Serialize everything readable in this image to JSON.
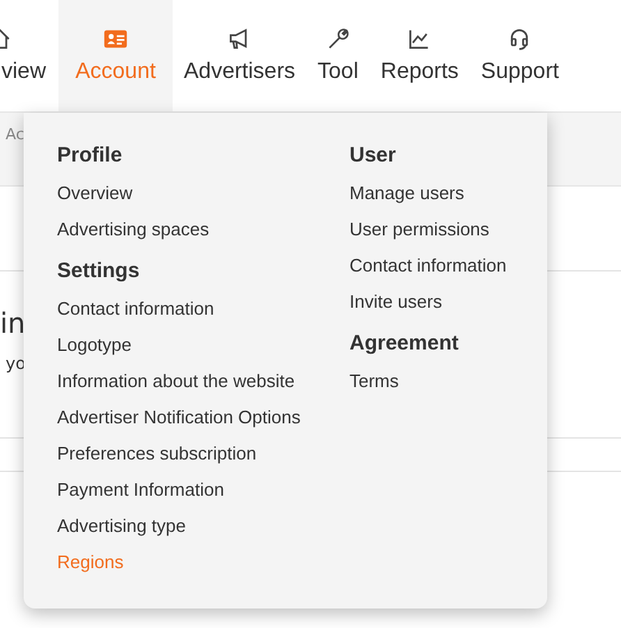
{
  "nav": [
    {
      "label": "view",
      "kind": "home",
      "selected": false
    },
    {
      "label": "Account",
      "kind": "card",
      "selected": true
    },
    {
      "label": "Advertisers",
      "kind": "megaphone",
      "selected": false
    },
    {
      "label": "Tool",
      "kind": "wrench",
      "selected": false
    },
    {
      "label": "Reports",
      "kind": "chart",
      "selected": false
    },
    {
      "label": "Support",
      "kind": "headset",
      "selected": false
    }
  ],
  "background": {
    "breadcrumb": "Ac",
    "heading": "in",
    "text": "yo"
  },
  "menu": {
    "columns": [
      [
        {
          "title": "Profile",
          "items": [
            {
              "label": "Overview",
              "selected": false
            },
            {
              "label": "Advertising spaces",
              "selected": false
            }
          ]
        },
        {
          "title": "Settings",
          "items": [
            {
              "label": "Contact information",
              "selected": false
            },
            {
              "label": "Logotype",
              "selected": false
            },
            {
              "label": "Information about the website",
              "selected": false
            },
            {
              "label": "Advertiser Notification Options",
              "selected": false
            },
            {
              "label": "Preferences subscription",
              "selected": false
            },
            {
              "label": "Payment Information",
              "selected": false
            },
            {
              "label": "Advertising type",
              "selected": false
            },
            {
              "label": "Regions",
              "selected": true
            }
          ]
        }
      ],
      [
        {
          "title": "User",
          "items": [
            {
              "label": "Manage users",
              "selected": false
            },
            {
              "label": "User permissions",
              "selected": false
            },
            {
              "label": "Contact information",
              "selected": false
            },
            {
              "label": "Invite users",
              "selected": false
            }
          ]
        },
        {
          "title": "Agreement",
          "items": [
            {
              "label": "Terms",
              "selected": false
            }
          ]
        }
      ]
    ]
  }
}
